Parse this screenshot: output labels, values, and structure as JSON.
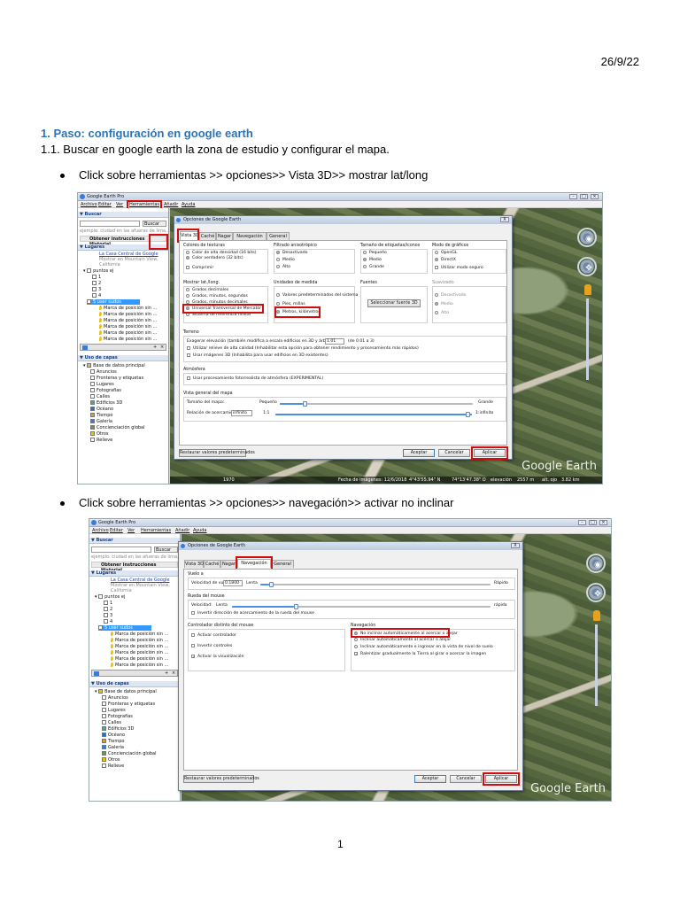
{
  "doc": {
    "date": "26/9/22",
    "heading": "1.  Paso: configuración en google earth",
    "subheading": "1.1. Buscar en google earth la zona de estudio y configurar el mapa.",
    "bullet1": "Click sobre herramientas >> opciones>> Vista 3D>> mostrar lat/long",
    "bullet2": "Click sobre herramientas >> opciones>> navegación>> activar no inclinar",
    "page_number": "1"
  },
  "ge": {
    "window_title": "Google Earth Pro",
    "menu": [
      "Archivo",
      "Editar",
      "Ver",
      "Herramientas",
      "Añadir",
      "Ayuda"
    ],
    "search_header": "Buscar",
    "search_button": "Buscar",
    "search_hint": "ejemplo: ciudad en las afueras de lima...",
    "directions_tabs": "Obtener instrucciones  Historial",
    "places_header": "Lugares",
    "place_link": "La Casa Central de Google",
    "place_sub1": "Mostrar en Mountain View,",
    "place_sub2": "California",
    "folder_points": "puntos ej",
    "folders": [
      "1",
      "2",
      "3",
      "4"
    ],
    "selected_folder": "5 user sudos",
    "markers": [
      "Marca de posición sin ...",
      "Marca de posición sin ...",
      "Marca de posición sin ...",
      "Marca de posición sin ...",
      "Marca de posición sin ...",
      "Marca de posición sin ..."
    ],
    "layers_header": "Uso de capas",
    "layers": [
      "Base de datos principal",
      "Anuncios",
      "Fronteras y etiquetas",
      "Lugares",
      "Fotografías",
      "Calles",
      "Edificios 3D",
      "Océano",
      "Tiempo",
      "Galería",
      "Concienciación global",
      "Otros",
      "Relieve"
    ],
    "brand": "Google Earth",
    "status": {
      "date": "Fecha de imágenes: 12/6/2018",
      "lat": "4°43'55.94\" N",
      "lon": "74°13'47.38\" O",
      "elev_label": "elevación",
      "elev": "2557 m",
      "alt_label": "alt. ojo",
      "alt": "3.82 km",
      "scale": "1970"
    }
  },
  "dialog": {
    "title": "Opciones de Google Earth",
    "close": "X",
    "tabs": [
      "Vista 3D",
      "Caché",
      "Nagar",
      "Navegación",
      "General"
    ],
    "restore_button": "Restaurar valores predeterminados",
    "ok_button": "Aceptar",
    "cancel_button": "Cancelar",
    "apply_button": "Aplicar"
  },
  "view3d": {
    "textures": {
      "title": "Colores de texturas",
      "options": [
        "Color de alta densidad (16 bits)",
        "Color verdadero (32 bits)"
      ],
      "check": "Comprimir"
    },
    "aniso": {
      "title": "Filtrado anisotrópico",
      "options": [
        "Desactivado",
        "Medio",
        "Alto"
      ]
    },
    "labels": {
      "title": "Tamaño de etiquetas/iconos",
      "options": [
        "Pequeño",
        "Medio",
        "Grande"
      ]
    },
    "graphics": {
      "title": "Modo de gráficos",
      "options": [
        "OpenGL",
        "DirectX"
      ],
      "check": "Utilizar modo seguro"
    },
    "latlong": {
      "title": "Mostrar lat./long.",
      "options": [
        "Grados decimales",
        "Grados, minutos, segundos",
        "Grados, minutos decimales",
        "Universal Transversal de Mercator",
        "Sistema de referencia militar"
      ]
    },
    "units": {
      "title": "Unidades de medida",
      "options": [
        "Valores predeterminados del sistema",
        "Pies, millas",
        "Metros, kilómetros"
      ]
    },
    "fonts": {
      "title": "Fuentes",
      "button": "Seleccionar fuente 3D"
    },
    "terrain_quality": {
      "title": "Suavizado",
      "options": [
        "Desactivado",
        "Medio",
        "Alto"
      ]
    },
    "terrain": {
      "title": "Terreno",
      "exaggeration": "Exagerar elevación (también modifica a escala edificios en 3D y árboles):",
      "exaggeration_value": "1.01",
      "exaggeration_range": "(de 0.01 a 3)",
      "check1": "Utilizar relieve de alta calidad (Inhabilitar esta opción para obtener rendimiento y procesamiento más rápidos)",
      "check2": "Usar imágenes 3D (Inhabilita para usar edificios en 3D existentes)"
    },
    "atmosphere": {
      "title": "Atmósfera",
      "check": "Usar procesamiento fotorrealista de atmósfera (EXPERIMENTAL)"
    },
    "overview": {
      "title": "Vista general del mapa",
      "size_label": "Tamaño del mapa:",
      "small": "Pequeño",
      "large": "Grande",
      "ratio_label": "Relación de acercamiento:",
      "ratio_value": "infinito",
      "one": "1:1",
      "infinite": "1:infinito"
    }
  },
  "nav": {
    "fly": {
      "title": "Vuelo a",
      "speed_label": "Velocidad de vuelo:",
      "speed_value": "0.1800",
      "slow": "Lenta",
      "fast": "Rápido"
    },
    "mouse": {
      "title": "Rueda del mouse",
      "speed_label": "Velocidad:",
      "slow": "Lenta",
      "fast": "rápida",
      "check": "Invertir dirección de acercamiento de la rueda del mouse"
    },
    "controller": {
      "title": "Controlador distinto del mouse",
      "checks": [
        "Activar controlador",
        "Invertir controles",
        "Activar la visualización"
      ]
    },
    "navigation": {
      "title": "Navegación",
      "options": [
        "No inclinar automáticamente al acercar o alejar",
        "Inclinar automáticamente al acercar o alejar",
        "Inclinar automáticamente e ingresar en la vista de nivel de suelo"
      ],
      "check": "Ralentizar gradualmente la Tierra al girar o acercar la imagen"
    }
  },
  "colors": {
    "heading": "#2e74b5",
    "highlight": "#d10d0d",
    "selection": "#3399ff"
  }
}
